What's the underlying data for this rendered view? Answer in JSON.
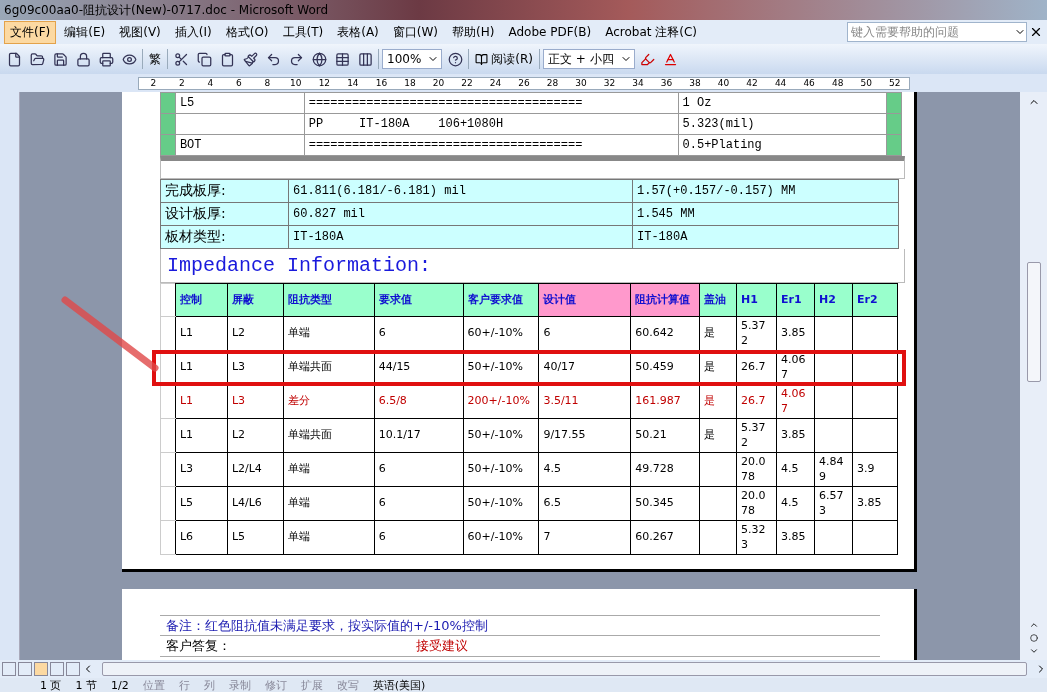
{
  "window": {
    "title": "6g09c00aa0-阻抗设计(New)-0717.doc - Microsoft Word"
  },
  "menu": [
    {
      "label": "文件(F)",
      "selected": true
    },
    {
      "label": "编辑(E)",
      "selected": false
    },
    {
      "label": "视图(V)",
      "selected": false
    },
    {
      "label": "插入(I)",
      "selected": false
    },
    {
      "label": "格式(O)",
      "selected": false
    },
    {
      "label": "工具(T)",
      "selected": false
    },
    {
      "label": "表格(A)",
      "selected": false
    },
    {
      "label": "窗口(W)",
      "selected": false
    },
    {
      "label": "帮助(H)",
      "selected": false
    },
    {
      "label": "Adobe PDF(B)",
      "selected": false
    },
    {
      "label": "Acrobat 注释(C)",
      "selected": false
    }
  ],
  "help_box": {
    "placeholder": "键入需要帮助的问题"
  },
  "toolbar": {
    "traditional": "繁",
    "zoom": "100%",
    "read_button": "阅读(R)",
    "style": "正文 + 小四"
  },
  "ruler": {
    "ticks": [
      "2",
      "2",
      "4",
      "6",
      "8",
      "10",
      "12",
      "14",
      "16",
      "18",
      "20",
      "22",
      "24",
      "26",
      "28",
      "30",
      "32",
      "34",
      "36",
      "38",
      "40",
      "42",
      "44",
      "46",
      "48",
      "50",
      "52"
    ]
  },
  "stackup_table": {
    "rows": [
      [
        "L5",
        "======================================",
        "1 Oz"
      ],
      [
        "",
        "PP     IT-180A    106+1080H",
        "5.323(mil)"
      ],
      [
        "BOT",
        "======================================",
        "0.5+Plating"
      ]
    ]
  },
  "thickness_table": {
    "rows": [
      [
        "完成板厚:",
        "61.811(6.181/-6.181) mil",
        "1.57(+0.157/-0.157) MM"
      ],
      [
        "设计板厚:",
        "60.827 mil",
        "1.545 MM"
      ],
      [
        "板材类型:",
        "IT-180A",
        "IT-180A"
      ]
    ]
  },
  "impedance_heading": "Impedance Information:",
  "impedance_table": {
    "columns": [
      {
        "label": "控制",
        "color": "#99ffcc"
      },
      {
        "label": "屏蔽",
        "color": "#99ffcc"
      },
      {
        "label": "阻抗类型",
        "color": "#99ffcc"
      },
      {
        "label": "要求值",
        "color": "#99ffcc"
      },
      {
        "label": "客户要求值",
        "color": "#99ffcc"
      },
      {
        "label": "设计值",
        "color": "#ff99cc"
      },
      {
        "label": "阻抗计算值",
        "color": "#ff99cc"
      },
      {
        "label": "盖油",
        "color": "#99ffcc"
      },
      {
        "label": "H1",
        "color": "#99ffcc"
      },
      {
        "label": "Er1",
        "color": "#99ffcc"
      },
      {
        "label": "H2",
        "color": "#99ffcc"
      },
      {
        "label": "Er2",
        "color": "#99ffcc"
      }
    ],
    "rows": [
      {
        "cells": [
          "L1",
          "L2",
          "单端",
          "6",
          "60+/-10%",
          "6",
          "60.642",
          "是",
          "5.372",
          "3.85",
          "",
          ""
        ],
        "failed": false,
        "marked": false
      },
      {
        "cells": [
          "L1",
          "L3",
          "单端共面",
          "44/15",
          "50+/-10%",
          "40/17",
          "50.459",
          "是",
          "26.7",
          "4.067",
          "",
          ""
        ],
        "failed": false,
        "marked": true
      },
      {
        "cells": [
          "L1",
          "L3",
          "差分",
          "6.5/8",
          "200+/-10%",
          "3.5/11",
          "161.987",
          "是",
          "26.7",
          "4.067",
          "",
          ""
        ],
        "failed": true,
        "marked": false
      },
      {
        "cells": [
          "L1",
          "L2",
          "单端共面",
          "10.1/17",
          "50+/-10%",
          "9/17.55",
          "50.21",
          "是",
          "5.372",
          "3.85",
          "",
          ""
        ],
        "failed": false,
        "marked": false
      },
      {
        "cells": [
          "L3",
          "L2/L4",
          "单端",
          "6",
          "50+/-10%",
          "4.5",
          "49.728",
          "",
          "20.078",
          "4.5",
          "4.849",
          "3.9"
        ],
        "failed": false,
        "marked": false
      },
      {
        "cells": [
          "L5",
          "L4/L6",
          "单端",
          "6",
          "50+/-10%",
          "6.5",
          "50.345",
          "",
          "20.078",
          "4.5",
          "6.573",
          "3.85"
        ],
        "failed": false,
        "marked": false
      },
      {
        "cells": [
          "L6",
          "L5",
          "单端",
          "6",
          "60+/-10%",
          "7",
          "60.267",
          "",
          "5.323",
          "3.85",
          "",
          ""
        ],
        "failed": false,
        "marked": false
      }
    ]
  },
  "notes": {
    "remark": "备注：红色阻抗值未满足要求，按实际值的+/-10%控制",
    "reply_label": "客户答复：",
    "reply": "接受建议"
  },
  "status_bar": {
    "items": [
      "1 页",
      "1 节",
      "1/2",
      "位置",
      "行",
      "列",
      "录制",
      "修订",
      "扩展",
      "改写",
      "英语(美国)"
    ]
  }
}
